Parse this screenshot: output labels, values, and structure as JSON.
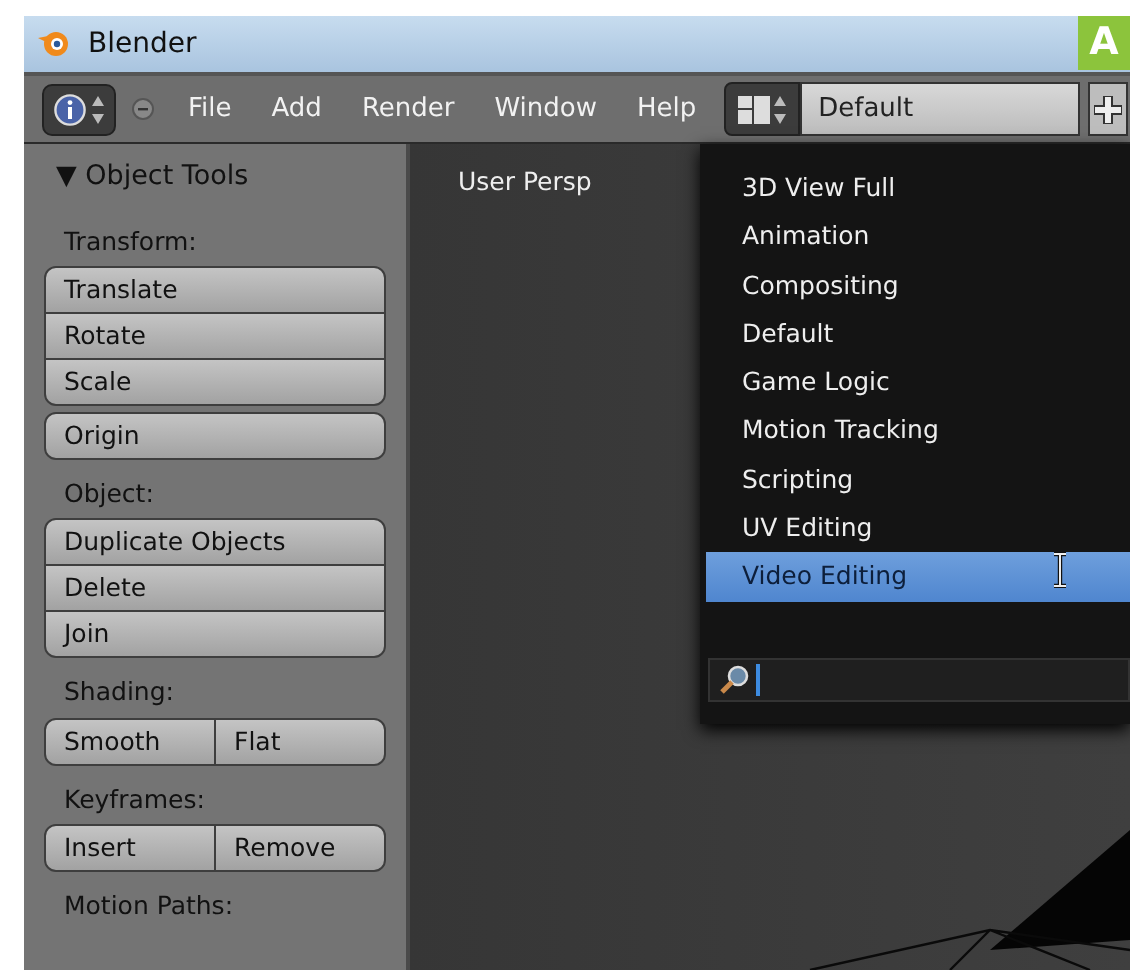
{
  "window": {
    "title": "Blender",
    "badge": "A"
  },
  "header": {
    "menus": [
      "File",
      "Add",
      "Render",
      "Window",
      "Help"
    ],
    "layout": "Default"
  },
  "tool_panel": {
    "title": "▼ Object Tools",
    "sections": [
      {
        "label": "Transform:",
        "kind": "stack",
        "buttons": [
          "Translate",
          "Rotate",
          "Scale"
        ]
      },
      {
        "kind": "stack",
        "buttons": [
          "Origin"
        ]
      },
      {
        "label": "Object:",
        "kind": "stack",
        "buttons": [
          "Duplicate Objects",
          "Delete",
          "Join"
        ]
      },
      {
        "label": "Shading:",
        "kind": "row",
        "buttons": [
          "Smooth",
          "Flat"
        ]
      },
      {
        "label": "Keyframes:",
        "kind": "row",
        "buttons": [
          "Insert",
          "Remove"
        ]
      },
      {
        "label": "Motion Paths:"
      }
    ]
  },
  "viewport": {
    "label": "User Persp"
  },
  "layout_menu": {
    "items": [
      {
        "label": "3D View Full",
        "selected": false
      },
      {
        "label": "Animation",
        "selected": false
      },
      {
        "label": "Compositing",
        "selected": false
      },
      {
        "label": "Default",
        "selected": false
      },
      {
        "label": "Game Logic",
        "selected": false
      },
      {
        "label": "Motion Tracking",
        "selected": false
      },
      {
        "label": "Scripting",
        "selected": false
      },
      {
        "label": "UV Editing",
        "selected": false
      },
      {
        "label": "Video Editing",
        "selected": true
      }
    ]
  }
}
